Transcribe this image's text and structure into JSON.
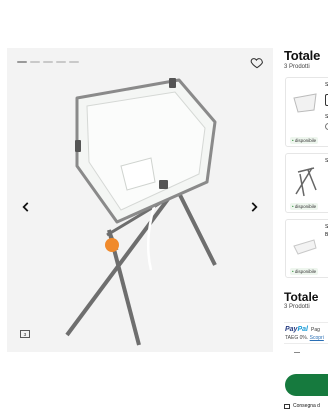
{
  "gallery": {
    "slide_count": 5,
    "active_slide": 1,
    "icons": {
      "wishlist": "heart-icon",
      "prev": "chevron-left-icon",
      "next": "chevron-right-icon",
      "media": "gallery-icon"
    }
  },
  "cart": {
    "title": "Totale",
    "count": "3 Prodotti",
    "items": [
      {
        "name": "S",
        "option": "S",
        "status": "disponibile"
      },
      {
        "name": "S",
        "status": "disponibile"
      },
      {
        "name": "S",
        "name2": "B",
        "status": "disponibile"
      }
    ],
    "status_dot": "•"
  },
  "summary": {
    "title": "Totale",
    "count": "3 Prodotti",
    "paypal": {
      "logo_part1": "Pay",
      "logo_part2": "Pal",
      "text": "Pag",
      "taeg": "TAEG 0%.",
      "link": "Scopri"
    },
    "qty_dash": "–",
    "delivery": "Consegna d"
  },
  "colors": {
    "accent": "#167a3e",
    "available": "#2f8f3a",
    "frame": "#6e6e6e",
    "bath": "#f4f6f4"
  }
}
